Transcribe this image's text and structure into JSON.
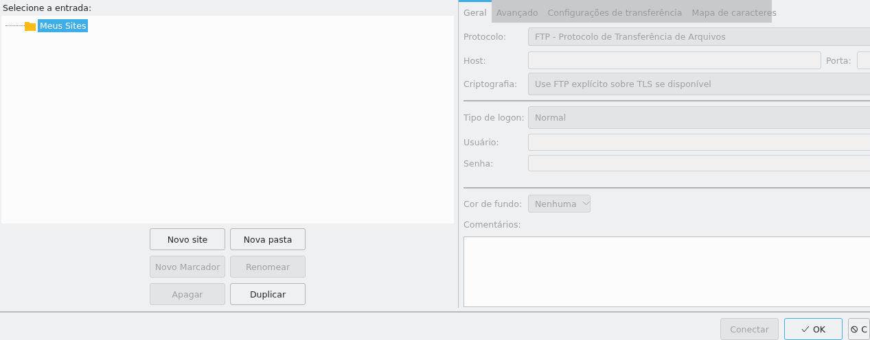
{
  "tree_label": "Selecione a entrada:",
  "tree": [
    {
      "label": "Meus Sites",
      "kind": "folder",
      "selected": true
    }
  ],
  "site_buttons": [
    {
      "label": "Novo site",
      "disabled": false
    },
    {
      "label": "Nova pasta",
      "disabled": false
    },
    {
      "label": "Novo Marcador",
      "disabled": true
    },
    {
      "label": "Renomear",
      "disabled": true
    },
    {
      "label": "Apagar",
      "disabled": true
    },
    {
      "label": "Duplicar",
      "disabled": false
    }
  ],
  "tabs": [
    {
      "label": "Geral",
      "selected": true
    },
    {
      "label": "Avançado",
      "selected": false
    },
    {
      "label": "Configurações de transferência",
      "selected": false
    },
    {
      "label": "Mapa de caracteres",
      "selected": false
    }
  ],
  "general": {
    "protocol": {
      "label": "Protocolo:",
      "value": "FTP - Protocolo de Transferência de Arquivos"
    },
    "host": {
      "label": "Host:"
    },
    "port": {
      "label": "Porta:"
    },
    "encryption": {
      "label": "Criptografia:",
      "value": "Use FTP explícito sobre TLS se disponível"
    },
    "logon_type": {
      "label": "Tipo de logon:",
      "value": "Normal"
    },
    "user": {
      "label": "Usuário:"
    },
    "password": {
      "label": "Senha:"
    },
    "background_color": {
      "label": "Cor de fundo:",
      "value": "Nenhuma"
    },
    "comments": {
      "label": "Comentários:"
    }
  },
  "dialog_buttons": [
    {
      "label": "Conectar",
      "kind": "plain",
      "disabled": true,
      "default": false
    },
    {
      "label": "OK",
      "kind": "check",
      "disabled": false,
      "default": true
    },
    {
      "label": "C",
      "kind": "cancel",
      "disabled": false,
      "default": false
    }
  ]
}
